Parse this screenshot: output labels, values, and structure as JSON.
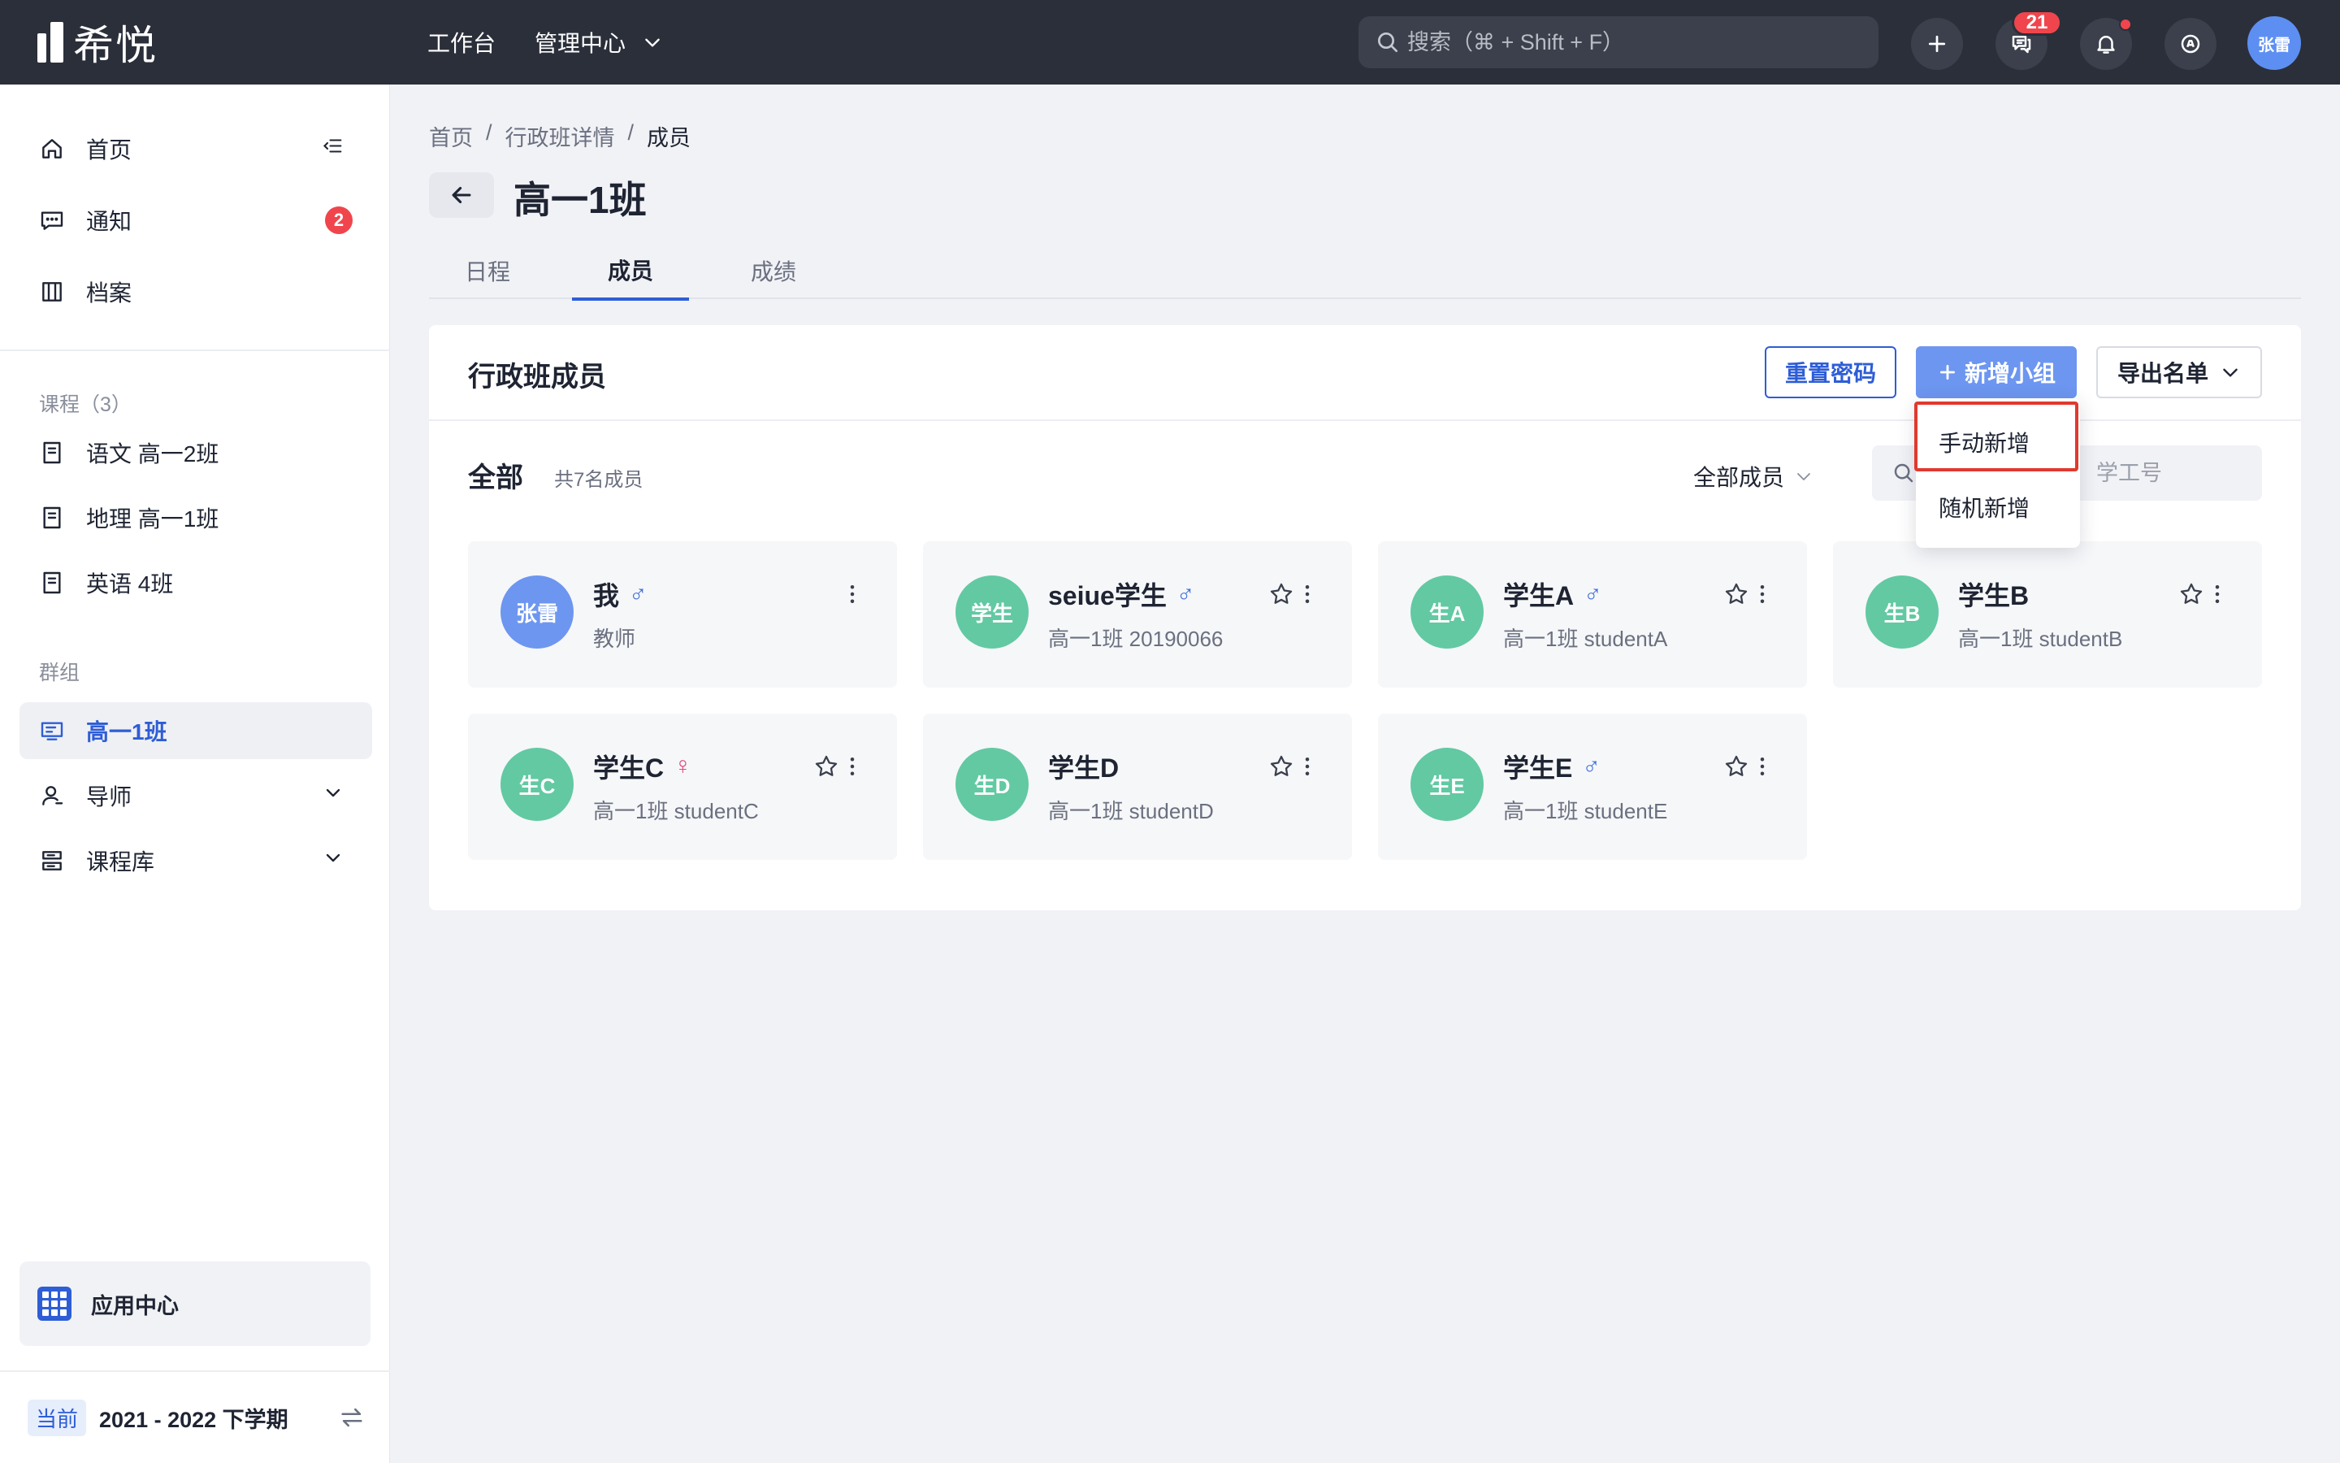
{
  "app": {
    "logo_text": "希悦",
    "nav": [
      {
        "label": "工作台"
      },
      {
        "label": "管理中心"
      }
    ],
    "search_placeholder": "搜索（⌘ + Shift + F）",
    "message_badge": "21",
    "user_avatar": "张雷",
    "brand_color": "#2e5dd6"
  },
  "sidebar": {
    "main_items": [
      {
        "label": "首页",
        "icon": "home-icon"
      },
      {
        "label": "通知",
        "icon": "message-icon",
        "badge": "2"
      },
      {
        "label": "档案",
        "icon": "archive-icon"
      }
    ],
    "courses_header": "课程（3）",
    "courses": [
      {
        "label": "语文 高一2班"
      },
      {
        "label": "地理 高一1班"
      },
      {
        "label": "英语 4班"
      }
    ],
    "groups_header": "群组",
    "groups": [
      {
        "label": "高一1班",
        "active": true
      },
      {
        "label": "导师"
      },
      {
        "label": "课程库"
      }
    ],
    "app_center": "应用中心",
    "term_tag": "当前",
    "term_label": "2021 - 2022 下学期"
  },
  "main": {
    "breadcrumb": [
      "首页",
      "行政班详情",
      "成员"
    ],
    "title": "高一1班",
    "tabs": [
      {
        "label": "日程"
      },
      {
        "label": "成员",
        "active": true
      },
      {
        "label": "成绩"
      }
    ],
    "panel": {
      "title": "行政班成员",
      "reset_password": "重置密码",
      "add_group": "新增小组",
      "export_list": "导出名单",
      "subsection_title": "全部",
      "member_count": "共7名成员",
      "filter_label": "全部成员",
      "search_placeholder": "学工号",
      "dropdown": [
        "手动新增",
        "随机新增"
      ]
    },
    "members": [
      {
        "avatar": "张雷",
        "name": "我",
        "gender": "♂",
        "gender_color": "#3f6fd8",
        "sub": "教师",
        "starred": false,
        "avatar_color": "#6d96f0"
      },
      {
        "avatar": "学生",
        "name": "seiue学生",
        "gender": "♂",
        "gender_color": "#3f6fd8",
        "sub": "高一1班 20190066",
        "starred": true,
        "avatar_color": "#62c9a3"
      },
      {
        "avatar": "生A",
        "name": "学生A",
        "gender": "♂",
        "gender_color": "#3f6fd8",
        "sub": "高一1班 studentA",
        "starred": true,
        "avatar_color": "#62c9a3"
      },
      {
        "avatar": "生B",
        "name": "学生B",
        "gender": "",
        "gender_color": "#3f6fd8",
        "sub": "高一1班 studentB",
        "starred": true,
        "avatar_color": "#62c9a3"
      },
      {
        "avatar": "生C",
        "name": "学生C",
        "gender": "♀",
        "gender_color": "#e0457a",
        "sub": "高一1班 studentC",
        "starred": true,
        "avatar_color": "#62c9a3"
      },
      {
        "avatar": "生D",
        "name": "学生D",
        "gender": "",
        "gender_color": "#3f6fd8",
        "sub": "高一1班 studentD",
        "starred": true,
        "avatar_color": "#62c9a3"
      },
      {
        "avatar": "生E",
        "name": "学生E",
        "gender": "♂",
        "gender_color": "#3f6fd8",
        "sub": "高一1班 studentE",
        "starred": true,
        "avatar_color": "#62c9a3"
      }
    ]
  }
}
